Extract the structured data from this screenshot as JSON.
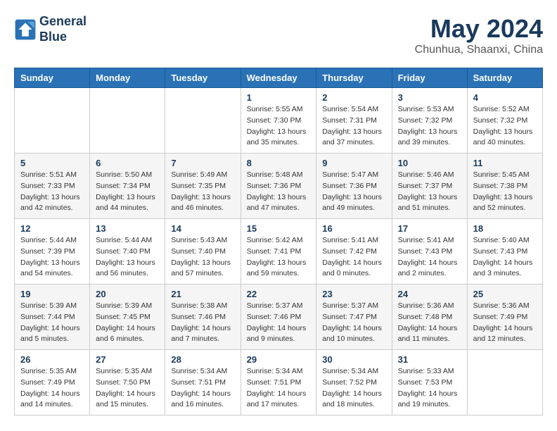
{
  "header": {
    "logo_line1": "General",
    "logo_line2": "Blue",
    "month": "May 2024",
    "location": "Chunhua, Shaanxi, China"
  },
  "weekdays": [
    "Sunday",
    "Monday",
    "Tuesday",
    "Wednesday",
    "Thursday",
    "Friday",
    "Saturday"
  ],
  "weeks": [
    [
      {
        "day": "",
        "info": ""
      },
      {
        "day": "",
        "info": ""
      },
      {
        "day": "",
        "info": ""
      },
      {
        "day": "1",
        "info": "Sunrise: 5:55 AM\nSunset: 7:30 PM\nDaylight: 13 hours\nand 35 minutes."
      },
      {
        "day": "2",
        "info": "Sunrise: 5:54 AM\nSunset: 7:31 PM\nDaylight: 13 hours\nand 37 minutes."
      },
      {
        "day": "3",
        "info": "Sunrise: 5:53 AM\nSunset: 7:32 PM\nDaylight: 13 hours\nand 39 minutes."
      },
      {
        "day": "4",
        "info": "Sunrise: 5:52 AM\nSunset: 7:32 PM\nDaylight: 13 hours\nand 40 minutes."
      }
    ],
    [
      {
        "day": "5",
        "info": "Sunrise: 5:51 AM\nSunset: 7:33 PM\nDaylight: 13 hours\nand 42 minutes."
      },
      {
        "day": "6",
        "info": "Sunrise: 5:50 AM\nSunset: 7:34 PM\nDaylight: 13 hours\nand 44 minutes."
      },
      {
        "day": "7",
        "info": "Sunrise: 5:49 AM\nSunset: 7:35 PM\nDaylight: 13 hours\nand 46 minutes."
      },
      {
        "day": "8",
        "info": "Sunrise: 5:48 AM\nSunset: 7:36 PM\nDaylight: 13 hours\nand 47 minutes."
      },
      {
        "day": "9",
        "info": "Sunrise: 5:47 AM\nSunset: 7:36 PM\nDaylight: 13 hours\nand 49 minutes."
      },
      {
        "day": "10",
        "info": "Sunrise: 5:46 AM\nSunset: 7:37 PM\nDaylight: 13 hours\nand 51 minutes."
      },
      {
        "day": "11",
        "info": "Sunrise: 5:45 AM\nSunset: 7:38 PM\nDaylight: 13 hours\nand 52 minutes."
      }
    ],
    [
      {
        "day": "12",
        "info": "Sunrise: 5:44 AM\nSunset: 7:39 PM\nDaylight: 13 hours\nand 54 minutes."
      },
      {
        "day": "13",
        "info": "Sunrise: 5:44 AM\nSunset: 7:40 PM\nDaylight: 13 hours\nand 56 minutes."
      },
      {
        "day": "14",
        "info": "Sunrise: 5:43 AM\nSunset: 7:40 PM\nDaylight: 13 hours\nand 57 minutes."
      },
      {
        "day": "15",
        "info": "Sunrise: 5:42 AM\nSunset: 7:41 PM\nDaylight: 13 hours\nand 59 minutes."
      },
      {
        "day": "16",
        "info": "Sunrise: 5:41 AM\nSunset: 7:42 PM\nDaylight: 14 hours\nand 0 minutes."
      },
      {
        "day": "17",
        "info": "Sunrise: 5:41 AM\nSunset: 7:43 PM\nDaylight: 14 hours\nand 2 minutes."
      },
      {
        "day": "18",
        "info": "Sunrise: 5:40 AM\nSunset: 7:43 PM\nDaylight: 14 hours\nand 3 minutes."
      }
    ],
    [
      {
        "day": "19",
        "info": "Sunrise: 5:39 AM\nSunset: 7:44 PM\nDaylight: 14 hours\nand 5 minutes."
      },
      {
        "day": "20",
        "info": "Sunrise: 5:39 AM\nSunset: 7:45 PM\nDaylight: 14 hours\nand 6 minutes."
      },
      {
        "day": "21",
        "info": "Sunrise: 5:38 AM\nSunset: 7:46 PM\nDaylight: 14 hours\nand 7 minutes."
      },
      {
        "day": "22",
        "info": "Sunrise: 5:37 AM\nSunset: 7:46 PM\nDaylight: 14 hours\nand 9 minutes."
      },
      {
        "day": "23",
        "info": "Sunrise: 5:37 AM\nSunset: 7:47 PM\nDaylight: 14 hours\nand 10 minutes."
      },
      {
        "day": "24",
        "info": "Sunrise: 5:36 AM\nSunset: 7:48 PM\nDaylight: 14 hours\nand 11 minutes."
      },
      {
        "day": "25",
        "info": "Sunrise: 5:36 AM\nSunset: 7:49 PM\nDaylight: 14 hours\nand 12 minutes."
      }
    ],
    [
      {
        "day": "26",
        "info": "Sunrise: 5:35 AM\nSunset: 7:49 PM\nDaylight: 14 hours\nand 14 minutes."
      },
      {
        "day": "27",
        "info": "Sunrise: 5:35 AM\nSunset: 7:50 PM\nDaylight: 14 hours\nand 15 minutes."
      },
      {
        "day": "28",
        "info": "Sunrise: 5:34 AM\nSunset: 7:51 PM\nDaylight: 14 hours\nand 16 minutes."
      },
      {
        "day": "29",
        "info": "Sunrise: 5:34 AM\nSunset: 7:51 PM\nDaylight: 14 hours\nand 17 minutes."
      },
      {
        "day": "30",
        "info": "Sunrise: 5:34 AM\nSunset: 7:52 PM\nDaylight: 14 hours\nand 18 minutes."
      },
      {
        "day": "31",
        "info": "Sunrise: 5:33 AM\nSunset: 7:53 PM\nDaylight: 14 hours\nand 19 minutes."
      },
      {
        "day": "",
        "info": ""
      }
    ]
  ]
}
